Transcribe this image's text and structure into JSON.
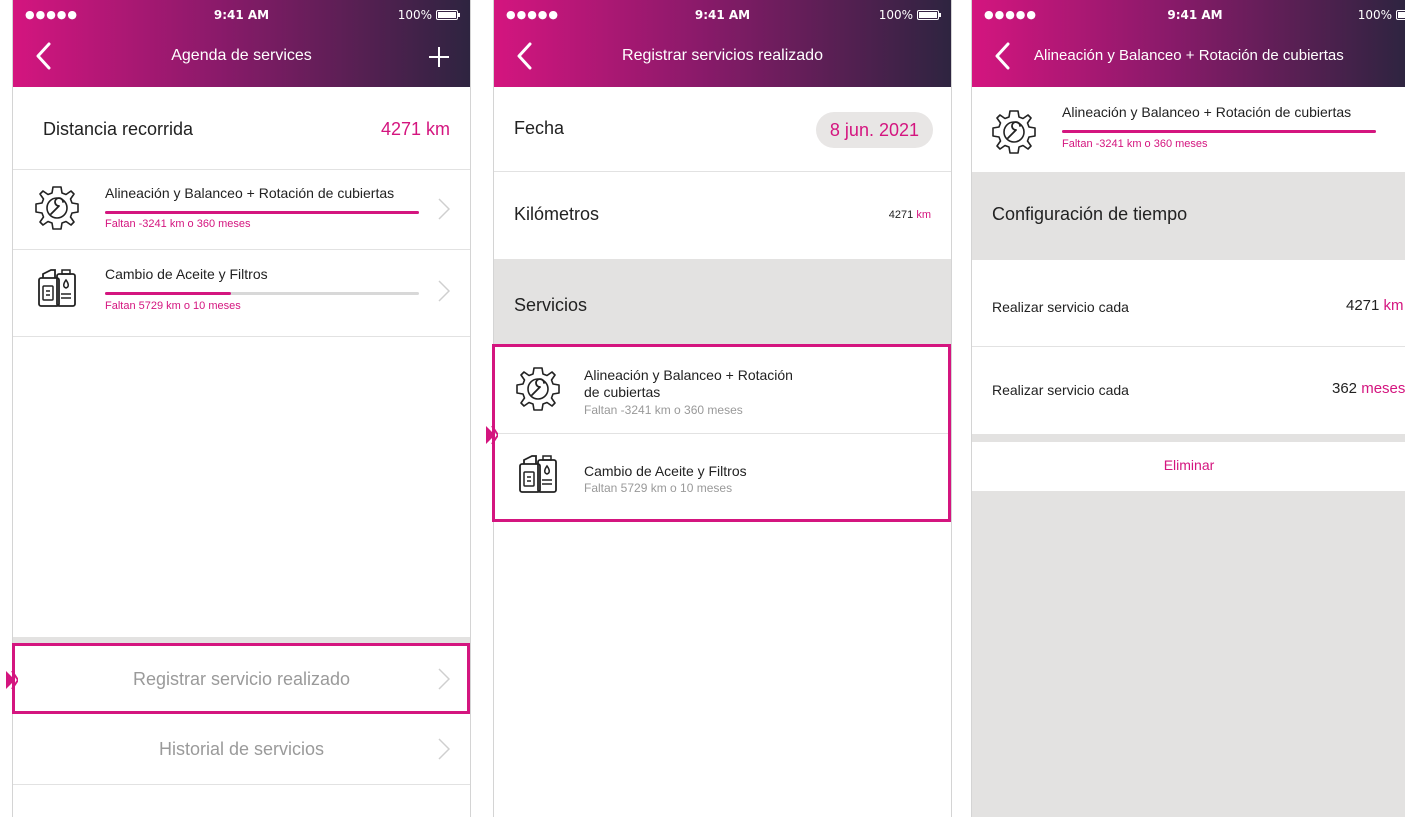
{
  "status_bar": {
    "signal": "●●●●● ",
    "time": "9:41 AM",
    "battery": "100%"
  },
  "colors": {
    "accent": "#d4157f",
    "header_start": "#d4157f",
    "header_end": "#2e2440",
    "band": "#e3e2e1"
  },
  "screen1": {
    "title": "Agenda de services",
    "distance_label": "Distancia recorrida",
    "distance_value": "4271 km",
    "services": [
      {
        "icon": "gear-wrench-icon",
        "title": "Alineación y Balanceo + Rotación de cubiertas",
        "subtitle": "Faltan -3241 km o 360 meses",
        "progress": 1.0
      },
      {
        "icon": "oil-can-icon",
        "title": "Cambio de Aceite y Filtros",
        "subtitle": "Faltan 5729 km o 10 meses",
        "progress": 0.4
      }
    ],
    "register_button": "Registrar servicio realizado",
    "history_button": "Historial de servicios"
  },
  "screen2": {
    "title": "Registrar servicios realizado",
    "date_label": "Fecha",
    "date_value": "8 jun. 2021",
    "km_label": "Kilómetros",
    "km_value": "4271",
    "km_unit": "km",
    "services_header": "Servicios",
    "services": [
      {
        "icon": "gear-wrench-icon",
        "title_line1": "Alineación y Balanceo + Rotación",
        "title_line2": "de cubiertas",
        "subtitle": "Faltan -3241 km o 360 meses"
      },
      {
        "icon": "oil-can-icon",
        "title_line1": "Cambio de Aceite y Filtros",
        "subtitle": "Faltan 5729 km o 10 meses"
      }
    ]
  },
  "screen3": {
    "title": "Alineación y Balanceo + Rotación de cubiertas",
    "service": {
      "icon": "gear-wrench-icon",
      "title": "Alineación y Balanceo + Rotación de cubiertas",
      "subtitle": "Faltan -3241 km o 360 meses",
      "progress": 1.0
    },
    "config_header": "Configuración de tiempo",
    "rows": [
      {
        "label": "Realizar servicio cada",
        "value": "4271",
        "unit": "km"
      },
      {
        "label": "Realizar servicio cada",
        "value": "362",
        "unit": "meses"
      }
    ],
    "delete_button": "Eliminar"
  }
}
